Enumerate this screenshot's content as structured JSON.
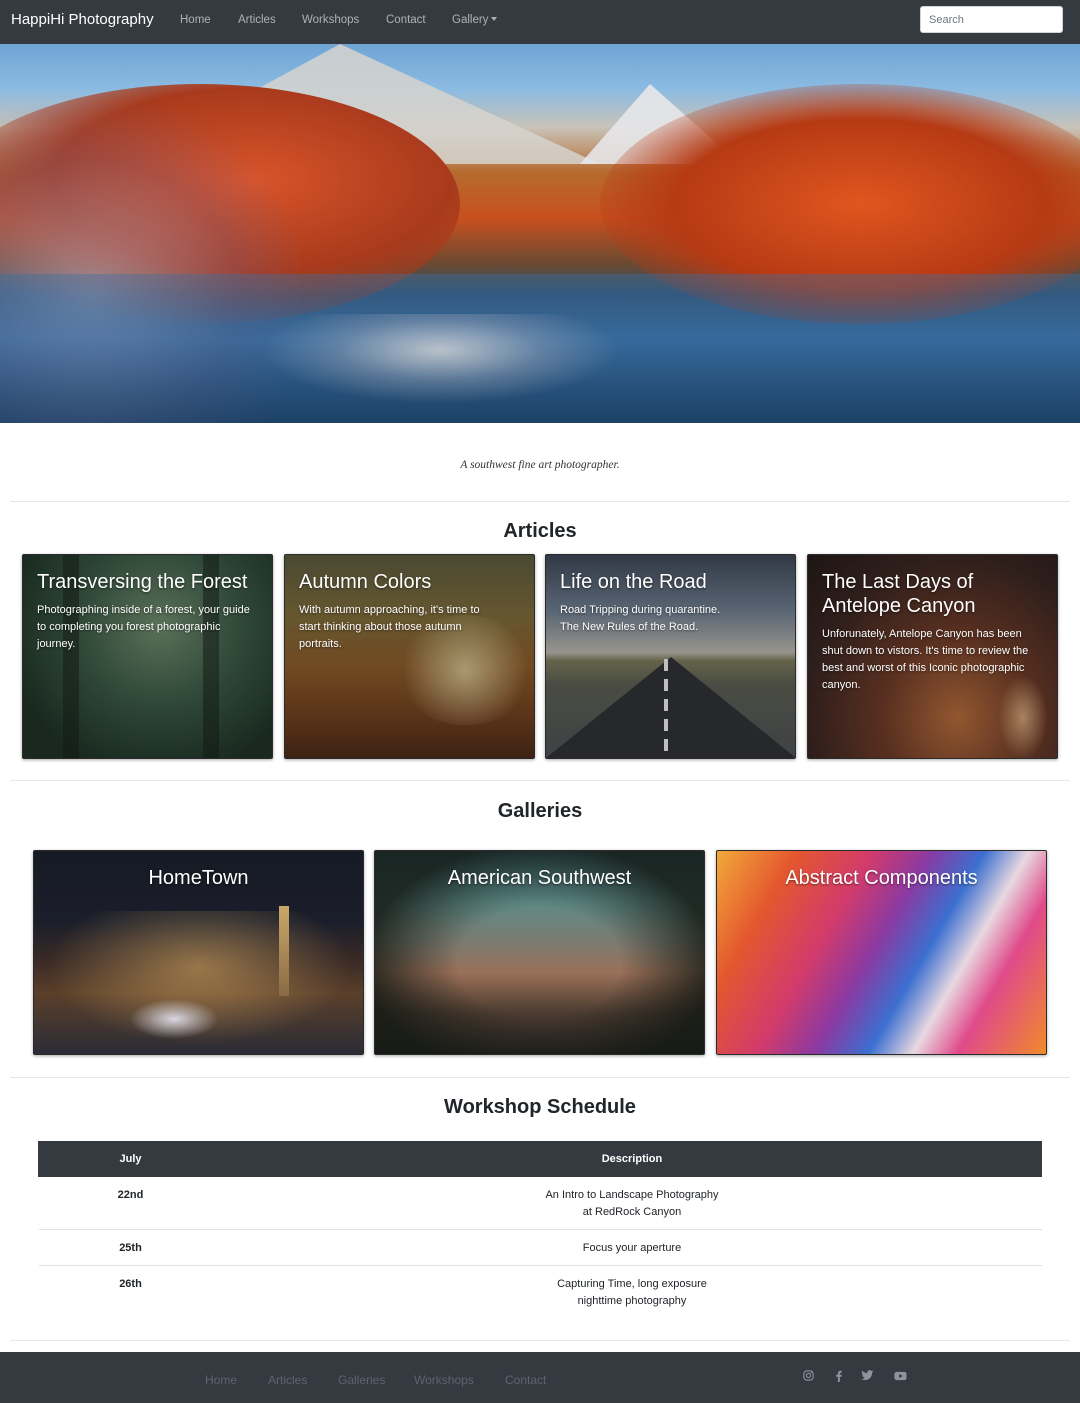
{
  "navbar": {
    "brand": "HappiHi Photography",
    "links": [
      "Home",
      "Articles",
      "Workshops",
      "Contact"
    ],
    "gallery_label": "Gallery",
    "search_placeholder": "Search"
  },
  "tagline": "A southwest fine art photographer.",
  "articles": {
    "heading": "Articles",
    "cards": [
      {
        "title": "Transversing the Forest",
        "text": "Photographing inside of a forest, your guide to completing you forest photographic journey."
      },
      {
        "title": "Autumn Colors",
        "text": "With autumn approaching, it's time to start thinking about those autumn portraits."
      },
      {
        "title": "Life on the Road",
        "text": "Road Tripping during quarantine. The New Rules of the Road."
      },
      {
        "title": "The Last Days of Antelope Canyon",
        "text": "Unforunately, Antelope Canyon has been shut down to vistors. It's time to review the best and worst of this Iconic photographic canyon."
      }
    ]
  },
  "galleries": {
    "heading": "Galleries",
    "cards": [
      {
        "title": "HomeTown"
      },
      {
        "title": "American Southwest"
      },
      {
        "title": "Abstract Components"
      }
    ]
  },
  "schedule": {
    "heading": "Workshop Schedule",
    "columns": [
      "July",
      "Description"
    ],
    "rows": [
      {
        "day": "22nd",
        "desc1": "An Intro to Landscape Photography",
        "desc2": "at RedRock Canyon"
      },
      {
        "day": "25th",
        "desc1": "Focus your aperture",
        "desc2": ""
      },
      {
        "day": "26th",
        "desc1": "Capturing Time, long exposure",
        "desc2": "nighttime photography"
      }
    ]
  },
  "footer": {
    "links": [
      "Home",
      "Articles",
      "Galleries",
      "Workshops",
      "Contact"
    ],
    "icons": [
      "instagram-icon",
      "facebook-icon",
      "twitter-icon",
      "youtube-icon"
    ]
  }
}
